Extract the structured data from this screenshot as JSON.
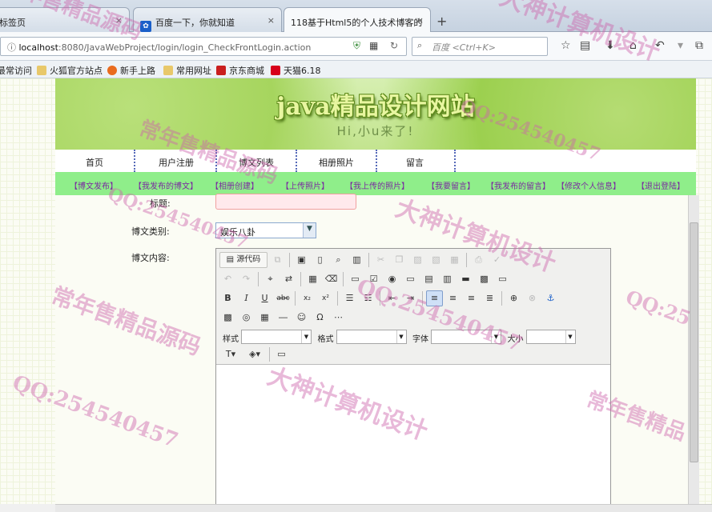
{
  "browser": {
    "tabs": [
      {
        "label": "标签页",
        "close": "×"
      },
      {
        "label": "百度一下，你就知道",
        "close": "×"
      },
      {
        "label": "118基于Html5的个人技术博客的",
        "close": "×"
      }
    ],
    "new_tab": "+",
    "address": {
      "host": "localhost",
      "path": ":8080/JavaWebProject/login/login_CheckFrontLogin.action"
    },
    "search_placeholder": "百度 <Ctrl+K>",
    "bookmarks": [
      "最常访问",
      "火狐官方站点",
      "新手上路",
      "常用网址",
      "京东商城",
      "天猫6.18"
    ]
  },
  "site": {
    "title": "java精品设计网站",
    "subtitle": "Hi,小u来了!",
    "main_nav": [
      "首页",
      "用户注册",
      "博文列表",
      "相册照片",
      "留言"
    ],
    "sub_nav": [
      "【博文发布】",
      "【我发布的博文】",
      "【相册创建】",
      "【上传照片】",
      "【我上传的照片】",
      "【我要留言】",
      "【我发布的留言】",
      "【修改个人信息】",
      "【退出登陆】"
    ]
  },
  "form": {
    "title_label": "标题:",
    "category_label": "博文类别:",
    "category_value": "娱乐八卦",
    "content_label": "博文内容:"
  },
  "editor": {
    "source_button": "源代码",
    "style_label": "样式",
    "format_label": "格式",
    "font_label": "字体",
    "size_label": "大小"
  },
  "watermarks": [
    "大神计算机设计",
    "常年售精品源码",
    "QQ:254540457",
    "大神计算机设计",
    "常年售精品源码",
    "QQ:254540457",
    "QQ:254540457",
    "大神计算机设计",
    "常年售精品源码",
    "QQ:254540457",
    "常年售精品",
    "QQ:25"
  ]
}
